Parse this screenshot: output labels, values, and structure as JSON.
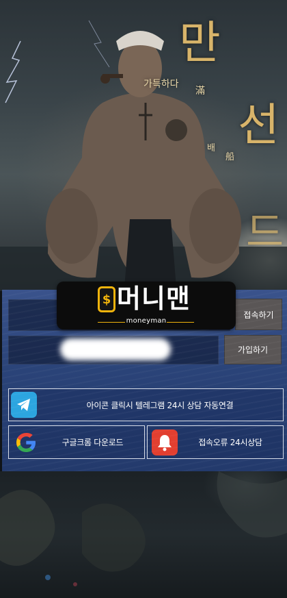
{
  "hero": {
    "calligraphy_main_1": "만",
    "calligraphy_main_2": "선",
    "calligraphy_main_3": "드",
    "calligraphy_sub_1": "가득하다",
    "calligraphy_sub_2": "滿",
    "calligraphy_sub_3": "배",
    "calligraphy_sub_4": "船"
  },
  "logo": {
    "coin_symbol": "$",
    "title": "머니맨",
    "subtitle": "moneyman"
  },
  "login": {
    "id_value": "",
    "pw_value": "",
    "login_button": "접속하기",
    "join_button": "가입하기"
  },
  "links": {
    "telegram_label": "아이콘 클릭시 텔레그램 24시 상담 자동연결",
    "chrome_label": "구글크롬 다운로드",
    "error_label": "접속오류 24시상담"
  },
  "icons": {
    "telegram": "telegram-icon",
    "chrome": "google-icon",
    "error": "bell-icon"
  },
  "colors": {
    "accent_gold": "#f1b40c",
    "panel_blue": "#2a4378",
    "button_gray": "#5a5656",
    "telegram_blue": "#2ca5e0",
    "alert_red": "#e23f30"
  }
}
